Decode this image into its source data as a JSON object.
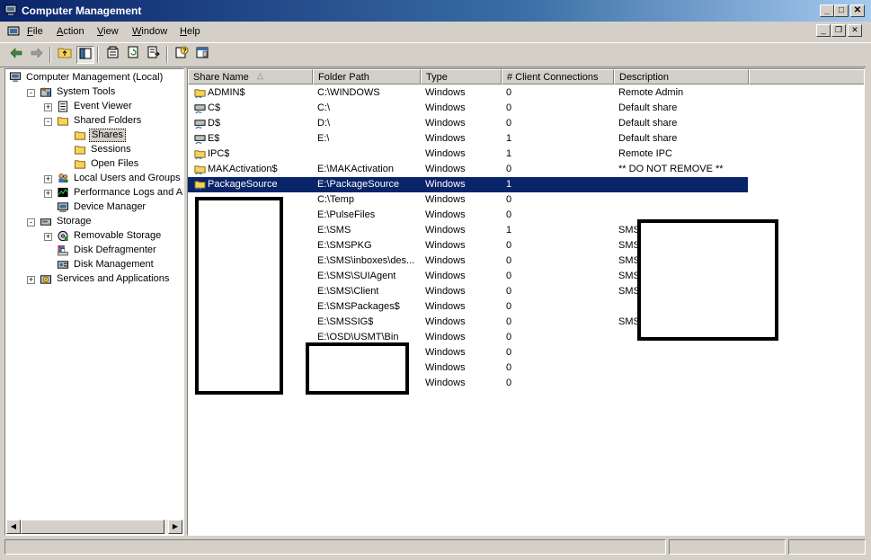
{
  "window": {
    "title": "Computer Management",
    "controls": [
      "_",
      "□",
      "✕"
    ]
  },
  "menubar": {
    "items": [
      {
        "label": "File",
        "accel": "F",
        "rest": "ile"
      },
      {
        "label": "Action",
        "accel": "A",
        "rest": "ction"
      },
      {
        "label": "View",
        "accel": "V",
        "rest": "iew"
      },
      {
        "label": "Window",
        "accel": "W",
        "rest": "indow"
      },
      {
        "label": "Help",
        "accel": "H",
        "rest": "elp"
      }
    ]
  },
  "toolbar": {
    "buttons": [
      "back-icon",
      "forward-icon",
      "up-folder-icon",
      "show-tree-icon",
      "properties-icon",
      "refresh-icon",
      "export-list-icon",
      "help-icon",
      "console-icon"
    ]
  },
  "tree": {
    "nodes": [
      {
        "label": "Computer Management (Local)",
        "level": 0,
        "expander": "",
        "icon": "computer-management-icon"
      },
      {
        "label": "System Tools",
        "level": 1,
        "expander": "-",
        "icon": "system-tools-icon"
      },
      {
        "label": "Event Viewer",
        "level": 2,
        "expander": "+",
        "icon": "event-viewer-icon"
      },
      {
        "label": "Shared Folders",
        "level": 2,
        "expander": "-",
        "icon": "folder-icon"
      },
      {
        "label": "Shares",
        "level": 3,
        "expander": "",
        "icon": "folder-icon",
        "selected": true
      },
      {
        "label": "Sessions",
        "level": 3,
        "expander": "",
        "icon": "folder-icon"
      },
      {
        "label": "Open Files",
        "level": 3,
        "expander": "",
        "icon": "folder-icon"
      },
      {
        "label": "Local Users and Groups",
        "level": 2,
        "expander": "+",
        "icon": "users-icon"
      },
      {
        "label": "Performance Logs and Alerts",
        "level": 2,
        "expander": "+",
        "icon": "performance-icon"
      },
      {
        "label": "Device Manager",
        "level": 2,
        "expander": "",
        "icon": "device-manager-icon"
      },
      {
        "label": "Storage",
        "level": 1,
        "expander": "-",
        "icon": "storage-icon"
      },
      {
        "label": "Removable Storage",
        "level": 2,
        "expander": "+",
        "icon": "removable-storage-icon"
      },
      {
        "label": "Disk Defragmenter",
        "level": 2,
        "expander": "",
        "icon": "defrag-icon"
      },
      {
        "label": "Disk Management",
        "level": 2,
        "expander": "",
        "icon": "disk-management-icon"
      },
      {
        "label": "Services and Applications",
        "level": 1,
        "expander": "+",
        "icon": "services-icon"
      }
    ]
  },
  "list": {
    "columns": [
      "Share Name",
      "Folder Path",
      "Type",
      "# Client Connections",
      "Description"
    ],
    "sort_indicator": "△",
    "rows": [
      {
        "name": "ADMIN$",
        "path": "C:\\WINDOWS",
        "type": "Windows",
        "clients": "0",
        "desc": "Remote Admin",
        "icon": "folder-share"
      },
      {
        "name": "C$",
        "path": "C:\\",
        "type": "Windows",
        "clients": "0",
        "desc": "Default share",
        "icon": "drive-share"
      },
      {
        "name": "D$",
        "path": "D:\\",
        "type": "Windows",
        "clients": "0",
        "desc": "Default share",
        "icon": "drive-share"
      },
      {
        "name": "E$",
        "path": "E:\\",
        "type": "Windows",
        "clients": "1",
        "desc": "Default share",
        "icon": "drive-share"
      },
      {
        "name": "IPC$",
        "path": "",
        "type": "Windows",
        "clients": "1",
        "desc": "Remote IPC",
        "icon": "folder-share"
      },
      {
        "name": "MAKActivation$",
        "path": "E:\\MAKActivation",
        "type": "Windows",
        "clients": "0",
        "desc": "** DO NOT REMOVE **",
        "icon": "folder-share"
      },
      {
        "name": "PackageSource",
        "path": "E:\\PackageSource",
        "type": "Windows",
        "clients": "1",
        "desc": "",
        "icon": "folder-share",
        "selected": true
      },
      {
        "name": "",
        "path": "C:\\Temp",
        "type": "Windows",
        "clients": "0",
        "desc": "",
        "icon": ""
      },
      {
        "name": "",
        "path": "E:\\PulseFiles",
        "type": "Windows",
        "clients": "0",
        "desc": "",
        "icon": ""
      },
      {
        "name": "",
        "path": "E:\\SMS",
        "type": "Windows",
        "clients": "1",
        "desc": "SMS",
        "icon": ""
      },
      {
        "name": "",
        "path": "E:\\SMSPKG",
        "type": "Windows",
        "clients": "0",
        "desc": "SMS",
        "icon": ""
      },
      {
        "name": "",
        "path": "E:\\SMS\\inboxes\\des...",
        "type": "Windows",
        "clients": "0",
        "desc": "SMS",
        "icon": ""
      },
      {
        "name": "",
        "path": "E:\\SMS\\SUIAgent",
        "type": "Windows",
        "clients": "0",
        "desc": "SMS",
        "icon": ""
      },
      {
        "name": "",
        "path": "E:\\SMS\\Client",
        "type": "Windows",
        "clients": "0",
        "desc": "SMS",
        "icon": ""
      },
      {
        "name": "",
        "path": "E:\\SMSPackages$",
        "type": "Windows",
        "clients": "0",
        "desc": "",
        "icon": ""
      },
      {
        "name": "",
        "path": "E:\\SMSSIG$",
        "type": "Windows",
        "clients": "0",
        "desc": "SMS",
        "icon": ""
      },
      {
        "name": "",
        "path": "E:\\OSD\\USMT\\Bin",
        "type": "Windows",
        "clients": "0",
        "desc": "",
        "icon": ""
      },
      {
        "name": "",
        "path": "",
        "type": "Windows",
        "clients": "0",
        "desc": "",
        "icon": ""
      },
      {
        "name": "",
        "path": "",
        "type": "Windows",
        "clients": "0",
        "desc": "",
        "icon": ""
      },
      {
        "name": "",
        "path": "",
        "type": "Windows",
        "clients": "0",
        "desc": "",
        "icon": ""
      }
    ]
  },
  "colors": {
    "title_bar_start": "#0a246a",
    "title_bar_end": "#a6caf0",
    "selection": "#0a246a",
    "chrome": "#d4d0c8"
  }
}
